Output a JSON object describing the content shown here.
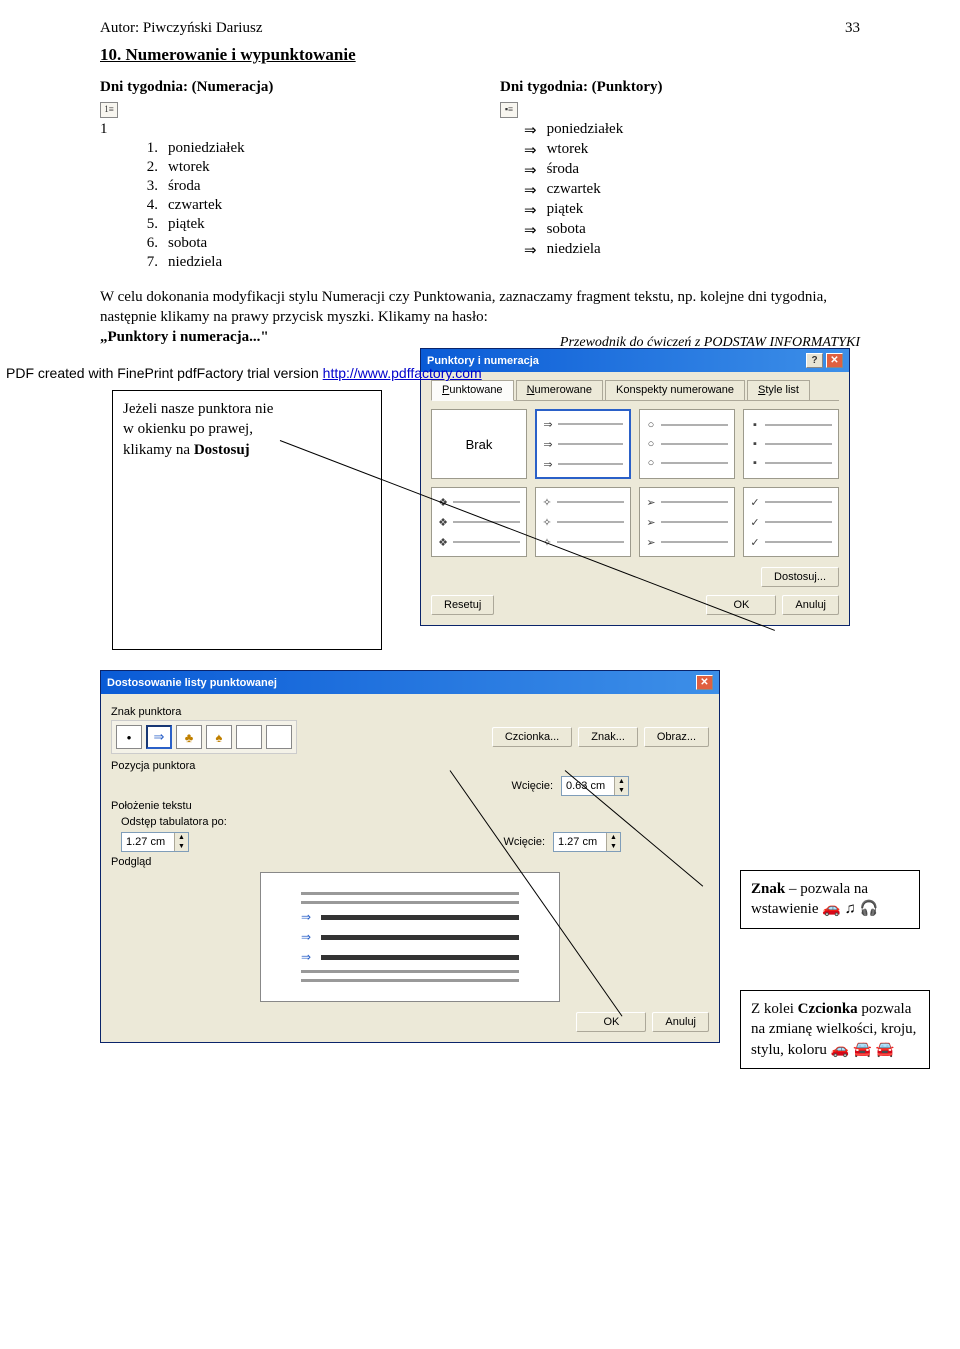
{
  "header": {
    "author": "Autor: Piwczyński Dariusz",
    "page_num": "33"
  },
  "section_title": "10. Numerowanie i wypunktowanie",
  "left_col": {
    "title": "Dni tygodnia: (Numeracja)",
    "lead": "1",
    "items": [
      {
        "n": "1.",
        "t": "poniedziałek"
      },
      {
        "n": "2.",
        "t": "wtorek"
      },
      {
        "n": "3.",
        "t": "środa"
      },
      {
        "n": "4.",
        "t": "czwartek"
      },
      {
        "n": "5.",
        "t": "piątek"
      },
      {
        "n": "6.",
        "t": "sobota"
      },
      {
        "n": "7.",
        "t": "niedziela"
      }
    ]
  },
  "right_col": {
    "title": "Dni tygodnia: (Punktory)",
    "items": [
      "poniedziałek",
      "wtorek",
      "środa",
      "czwartek",
      "piątek",
      "sobota",
      "niedziela"
    ]
  },
  "body_para": "W celu dokonania modyfikacji stylu Numeracji czy Punktowania, zaznaczamy fragment tekstu, np. kolejne dni tygodnia, następnie klikamy na prawy przycisk myszki. Klikamy na hasło: ",
  "body_para_bold": "„Punktory i numeracja...\"",
  "note_left_l1": "Jeżeli nasze punktora nie",
  "note_left_l2": "w okienku po prawej,",
  "note_left_l3_a": "klikamy na ",
  "note_left_l3_b": "Dostosuj",
  "dlg1": {
    "title": "Punktory i numeracja",
    "tabs": {
      "t1": "Punktowane",
      "t2": "Numerowane",
      "t3": "Konspekty numerowane",
      "t4": "Style list"
    },
    "brak": "Brak",
    "btn_dostosuj": "Dostosuj...",
    "btn_reset": "Resetuj",
    "btn_ok": "OK",
    "btn_cancel": "Anuluj"
  },
  "dlg2": {
    "title": "Dostosowanie listy punktowanej",
    "znak_punktora": "Znak punktora",
    "btn_czcionka": "Czcionka...",
    "btn_znak": "Znak...",
    "btn_obraz": "Obraz...",
    "pozycja": "Pozycja punktora",
    "wciecie": "Wcięcie:",
    "wc1": "0.63 cm",
    "polozenie": "Położenie tekstu",
    "odstep": "Odstęp tabulatora po:",
    "tab_val": "1.27 cm",
    "wc2": "1.27 cm",
    "podglad": "Podgląd",
    "btn_ok": "OK",
    "btn_cancel": "Anuluj"
  },
  "note_znak_a": "Znak",
  "note_znak_b": " – pozwala na wstawienie ",
  "note_znak_ico": "🚗 ♫ 🎧",
  "note_czc_a": "Z kolei ",
  "note_czc_b": "Czcionka",
  "note_czc_c": " pozwala na zmianę wielkości, kroju, stylu, koloru 🚗   🚘 🚘",
  "footer": "Przewodnik do ćwiczeń z PODSTAW INFORMATYKI",
  "pdf_line_a": "PDF created with FinePrint pdfFactory trial version ",
  "pdf_line_b": "http://www.pdffactory.com"
}
